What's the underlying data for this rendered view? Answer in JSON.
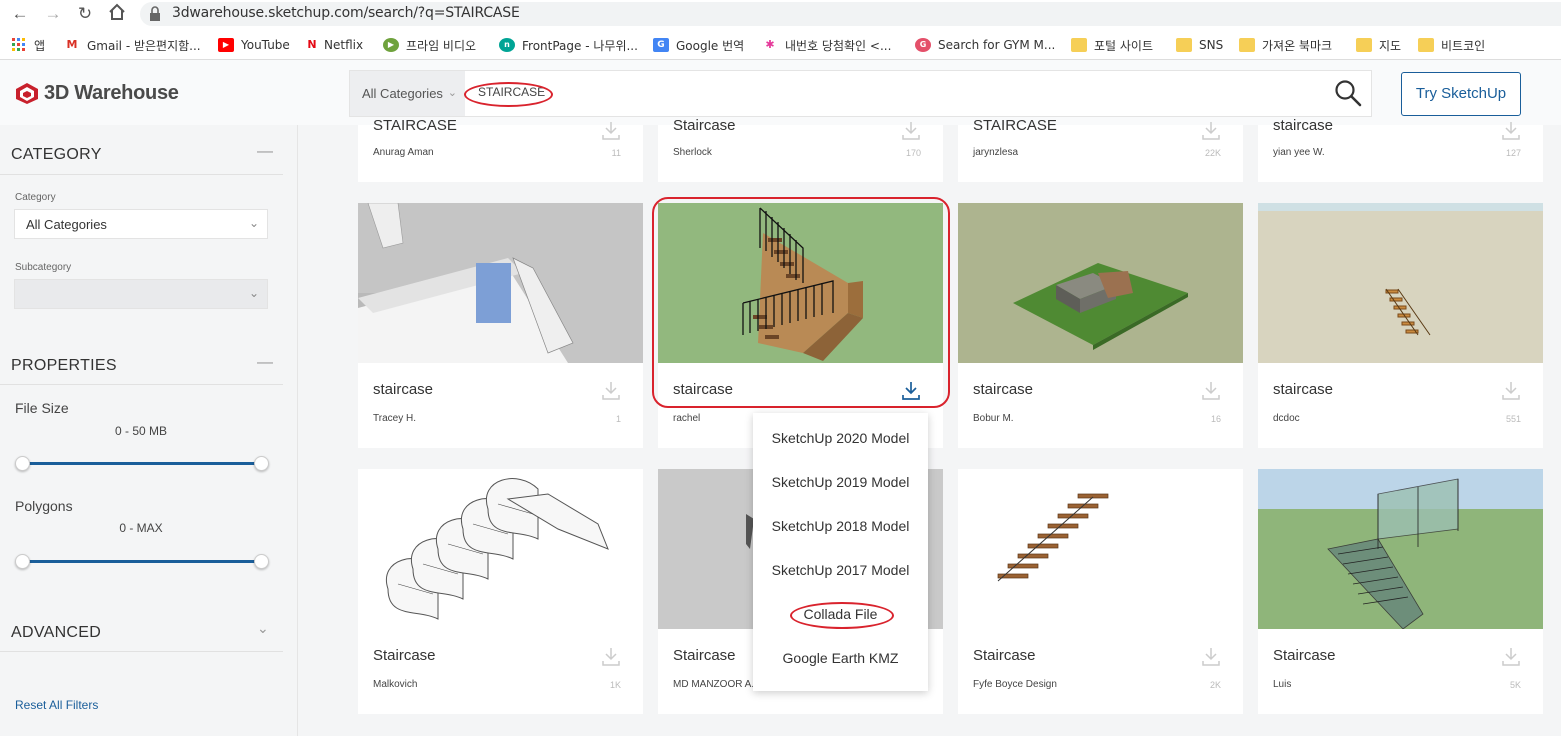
{
  "browser": {
    "url": "3dwarehouse.sketchup.com/search/?q=STAIRCASE",
    "bookmarks": [
      {
        "label": "앱",
        "icon": "apps-grid-icon"
      },
      {
        "label": "Gmail - 받은편지함...",
        "icon": "gmail-icon"
      },
      {
        "label": "YouTube",
        "icon": "youtube-icon"
      },
      {
        "label": "Netflix",
        "icon": "netflix-icon"
      },
      {
        "label": "프라임 비디오",
        "icon": "prime-video-icon"
      },
      {
        "label": "FrontPage - 나무위...",
        "icon": "namuwiki-icon"
      },
      {
        "label": "Google 번역",
        "icon": "google-translate-icon"
      },
      {
        "label": "내번호 당첨확인 <...",
        "icon": "lottery-icon"
      },
      {
        "label": "Search for GYM M...",
        "icon": "gym-search-icon"
      },
      {
        "label": "포털 사이트",
        "icon": "folder-icon"
      },
      {
        "label": "SNS",
        "icon": "folder-icon"
      },
      {
        "label": "가져온 북마크",
        "icon": "folder-icon"
      },
      {
        "label": "지도",
        "icon": "folder-icon"
      },
      {
        "label": "비트코인",
        "icon": "folder-icon"
      }
    ]
  },
  "header": {
    "logo_text": "3D Warehouse",
    "category_select": "All Categories",
    "search_query": "STAIRCASE",
    "try_button": "Try SketchUp"
  },
  "sidebar": {
    "category_heading": "CATEGORY",
    "category_label": "Category",
    "category_value": "All Categories",
    "subcategory_label": "Subcategory",
    "subcategory_value": "",
    "properties_heading": "PROPERTIES",
    "file_size_label": "File Size",
    "file_size_range": "0 - 50 MB",
    "polygons_label": "Polygons",
    "polygons_range": "0 - MAX",
    "advanced_heading": "ADVANCED",
    "reset_link": "Reset All Filters"
  },
  "results": {
    "row1": [
      {
        "title": "STAIRCASE",
        "author": "Anurag Aman",
        "count": "11"
      },
      {
        "title": "Staircase",
        "author": "Sherlock",
        "count": "170"
      },
      {
        "title": "STAIRCASE",
        "author": "jarynzlesa",
        "count": "22K"
      },
      {
        "title": "staircase",
        "author": "yian yee W.",
        "count": "127"
      }
    ],
    "row2": [
      {
        "title": "staircase",
        "author": "Tracey H.",
        "count": "1"
      },
      {
        "title": "staircase",
        "author": "rachel",
        "count": ""
      },
      {
        "title": "staircase",
        "author": "Bobur M.",
        "count": "16"
      },
      {
        "title": "staircase",
        "author": "dcdoc",
        "count": "551"
      }
    ],
    "row3": [
      {
        "title": "Staircase",
        "author": "Malkovich",
        "count": "1K"
      },
      {
        "title": "Staircase",
        "author": "MD MANZOOR A...",
        "count": ""
      },
      {
        "title": "Staircase",
        "author": "Fyfe Boyce Design",
        "count": "2K"
      },
      {
        "title": "Staircase",
        "author": "Luis",
        "count": "5K"
      }
    ]
  },
  "download_menu": {
    "items": [
      "SketchUp 2020 Model",
      "SketchUp 2019 Model",
      "SketchUp 2018 Model",
      "SketchUp 2017 Model",
      "Collada File",
      "Google Earth KMZ"
    ]
  },
  "colors": {
    "accent_blue": "#1a5e9a",
    "highlight_red": "#d9232d",
    "logo_red": "#c8202c"
  }
}
